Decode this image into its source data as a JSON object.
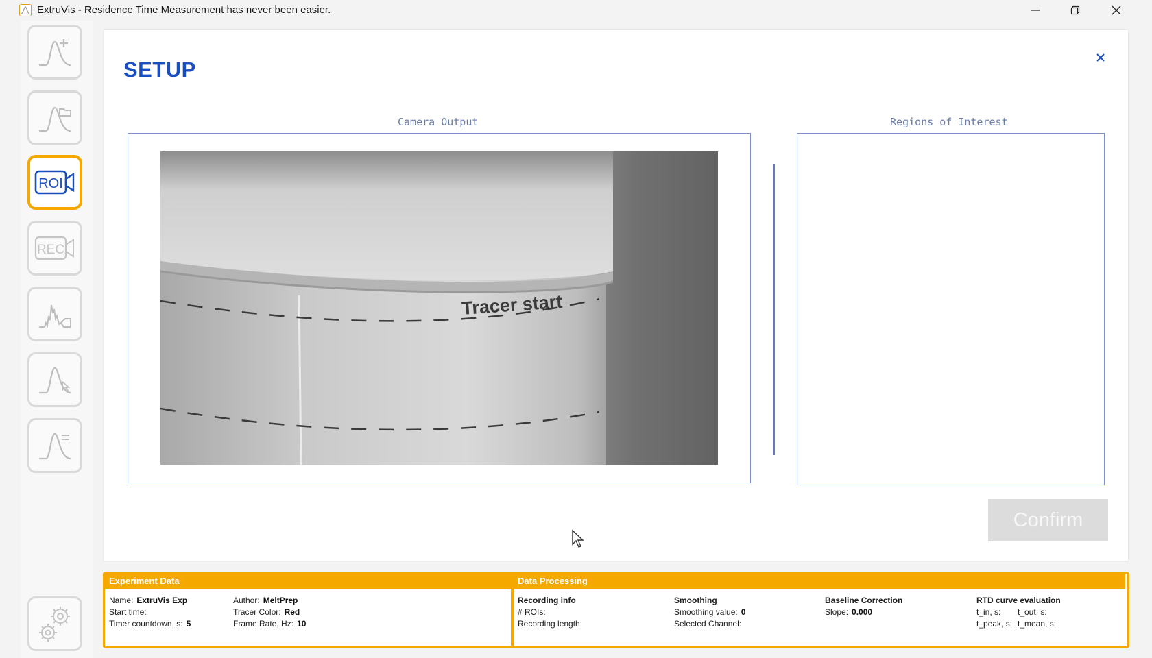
{
  "window": {
    "title": "ExtruVis - Residence Time Measurement has never been easier."
  },
  "sidebar": {
    "items": [
      {
        "name": "new-measurement",
        "label": ""
      },
      {
        "name": "open-measurement",
        "label": ""
      },
      {
        "name": "roi",
        "label": "ROI"
      },
      {
        "name": "rec",
        "label": "REC"
      },
      {
        "name": "processing",
        "label": ""
      },
      {
        "name": "peak-evaluation",
        "label": ""
      },
      {
        "name": "curve-results",
        "label": ""
      }
    ],
    "active": "roi"
  },
  "setup": {
    "title": "SETUP",
    "camera_label": "Camera Output",
    "roi_label": "Regions of Interest",
    "camera_text": "Tracer start",
    "confirm_label": "Confirm"
  },
  "experiment": {
    "header": "Experiment Data",
    "name_label": "Name:",
    "name_value": "ExtruVis Exp",
    "author_label": "Author:",
    "author_value": "MeltPrep",
    "start_label": "Start time:",
    "start_value": "",
    "tracer_label": "Tracer Color:",
    "tracer_value": "Red",
    "timer_label": "Timer countdown, s:",
    "timer_value": "5",
    "frame_label": "Frame Rate, Hz:",
    "frame_value": "10"
  },
  "processing": {
    "header": "Data Processing",
    "recording_title": "Recording info",
    "rois_label": "# ROIs:",
    "rois_value": "",
    "length_label": "Recording length:",
    "length_value": "",
    "smoothing_title": "Smoothing",
    "smoothing_value_label": "Smoothing value:",
    "smoothing_value": "0",
    "channel_label": "Selected Channel:",
    "channel_value": "",
    "baseline_title": "Baseline Correction",
    "slope_label": "Slope:",
    "slope_value": "0.000",
    "rtd_title": "RTD curve evaluation",
    "t_in": "t_in, s:",
    "t_out": "t_out, s:",
    "t_peak": "t_peak, s:",
    "t_mean": "t_mean, s:"
  },
  "colors": {
    "accent": "#f5a800",
    "title_blue": "#1a4fbf",
    "frame_blue": "#7f92c6"
  }
}
